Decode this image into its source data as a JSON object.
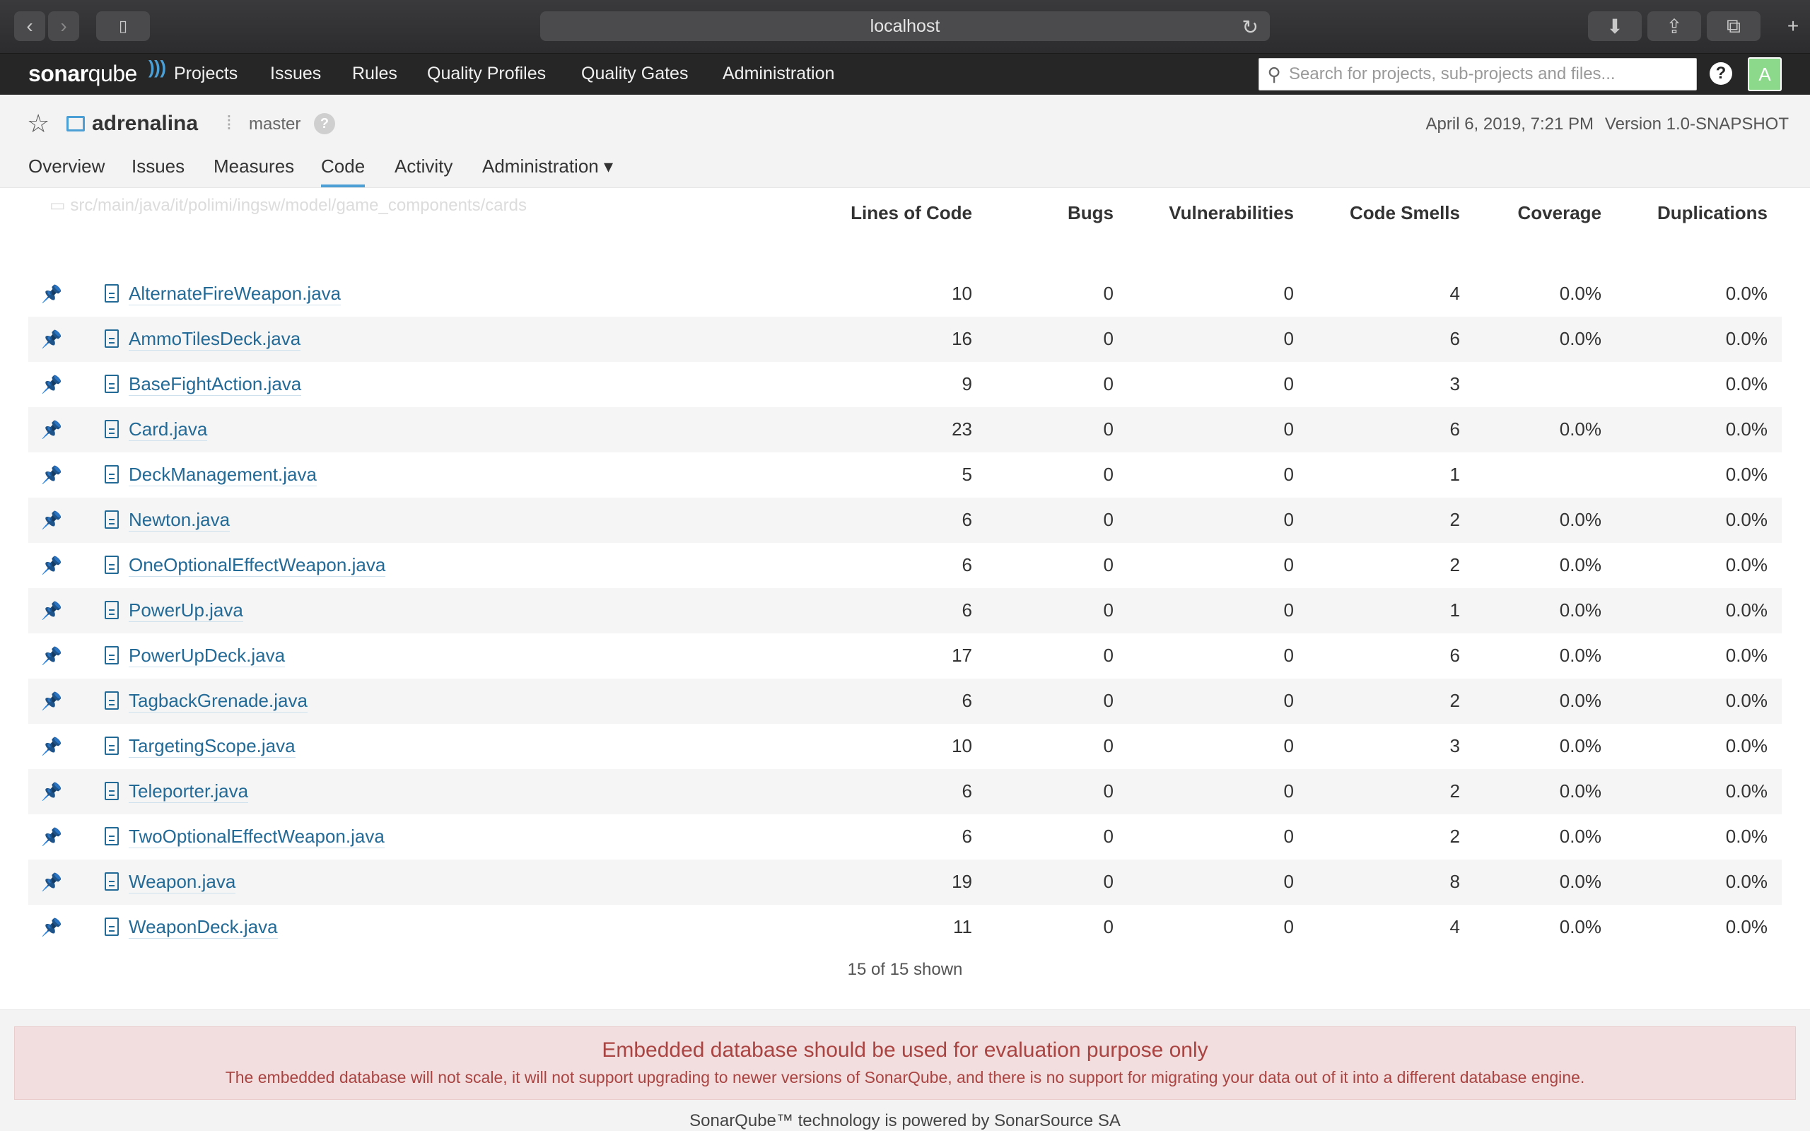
{
  "browser": {
    "address": "localhost"
  },
  "nav": {
    "logo_main": "sonar",
    "logo_sub": "qube",
    "items": [
      "Projects",
      "Issues",
      "Rules",
      "Quality Profiles",
      "Quality Gates",
      "Administration"
    ],
    "search_placeholder": "Search for projects, sub-projects and files...",
    "help": "?",
    "avatar": "A"
  },
  "project": {
    "name": "adrenalina",
    "branch": "master",
    "branch_help": "?",
    "date": "April 6, 2019, 7:21 PM",
    "version": "Version 1.0-SNAPSHOT",
    "tabs": [
      "Overview",
      "Issues",
      "Measures",
      "Code",
      "Activity",
      "Administration ▾"
    ],
    "active_tab": "Code"
  },
  "ghost_path": "src/main/java/it/polimi/ingsw/model/game_components/cards",
  "table": {
    "headers": {
      "loc": "Lines of Code",
      "bugs": "Bugs",
      "vulns": "Vulnerabilities",
      "smells": "Code Smells",
      "coverage": "Coverage",
      "dup": "Duplications"
    },
    "rows": [
      {
        "name": "AlternateFireWeapon.java",
        "loc": "10",
        "bugs": "0",
        "vulns": "0",
        "smells": "4",
        "coverage": "0.0%",
        "dup": "0.0%"
      },
      {
        "name": "AmmoTilesDeck.java",
        "loc": "16",
        "bugs": "0",
        "vulns": "0",
        "smells": "6",
        "coverage": "0.0%",
        "dup": "0.0%"
      },
      {
        "name": "BaseFightAction.java",
        "loc": "9",
        "bugs": "0",
        "vulns": "0",
        "smells": "3",
        "coverage": "",
        "dup": "0.0%"
      },
      {
        "name": "Card.java",
        "loc": "23",
        "bugs": "0",
        "vulns": "0",
        "smells": "6",
        "coverage": "0.0%",
        "dup": "0.0%"
      },
      {
        "name": "DeckManagement.java",
        "loc": "5",
        "bugs": "0",
        "vulns": "0",
        "smells": "1",
        "coverage": "",
        "dup": "0.0%"
      },
      {
        "name": "Newton.java",
        "loc": "6",
        "bugs": "0",
        "vulns": "0",
        "smells": "2",
        "coverage": "0.0%",
        "dup": "0.0%"
      },
      {
        "name": "OneOptionalEffectWeapon.java",
        "loc": "6",
        "bugs": "0",
        "vulns": "0",
        "smells": "2",
        "coverage": "0.0%",
        "dup": "0.0%"
      },
      {
        "name": "PowerUp.java",
        "loc": "6",
        "bugs": "0",
        "vulns": "0",
        "smells": "1",
        "coverage": "0.0%",
        "dup": "0.0%"
      },
      {
        "name": "PowerUpDeck.java",
        "loc": "17",
        "bugs": "0",
        "vulns": "0",
        "smells": "6",
        "coverage": "0.0%",
        "dup": "0.0%"
      },
      {
        "name": "TagbackGrenade.java",
        "loc": "6",
        "bugs": "0",
        "vulns": "0",
        "smells": "2",
        "coverage": "0.0%",
        "dup": "0.0%"
      },
      {
        "name": "TargetingScope.java",
        "loc": "10",
        "bugs": "0",
        "vulns": "0",
        "smells": "3",
        "coverage": "0.0%",
        "dup": "0.0%"
      },
      {
        "name": "Teleporter.java",
        "loc": "6",
        "bugs": "0",
        "vulns": "0",
        "smells": "2",
        "coverage": "0.0%",
        "dup": "0.0%"
      },
      {
        "name": "TwoOptionalEffectWeapon.java",
        "loc": "6",
        "bugs": "0",
        "vulns": "0",
        "smells": "2",
        "coverage": "0.0%",
        "dup": "0.0%"
      },
      {
        "name": "Weapon.java",
        "loc": "19",
        "bugs": "0",
        "vulns": "0",
        "smells": "8",
        "coverage": "0.0%",
        "dup": "0.0%"
      },
      {
        "name": "WeaponDeck.java",
        "loc": "11",
        "bugs": "0",
        "vulns": "0",
        "smells": "4",
        "coverage": "0.0%",
        "dup": "0.0%"
      }
    ],
    "shown": "15 of 15 shown"
  },
  "alert": {
    "title": "Embedded database should be used for evaluation purpose only",
    "body": "The embedded database will not scale, it will not support upgrading to newer versions of SonarQube, and there is no support for migrating your data out of it into a different database engine."
  },
  "footer": {
    "powered": "SonarQube™ technology is powered by SonarSource SA"
  },
  "colors": {
    "link": "#236a97",
    "accent": "#4b9fd5",
    "navbar": "#262626",
    "alert_text": "#a94442"
  }
}
